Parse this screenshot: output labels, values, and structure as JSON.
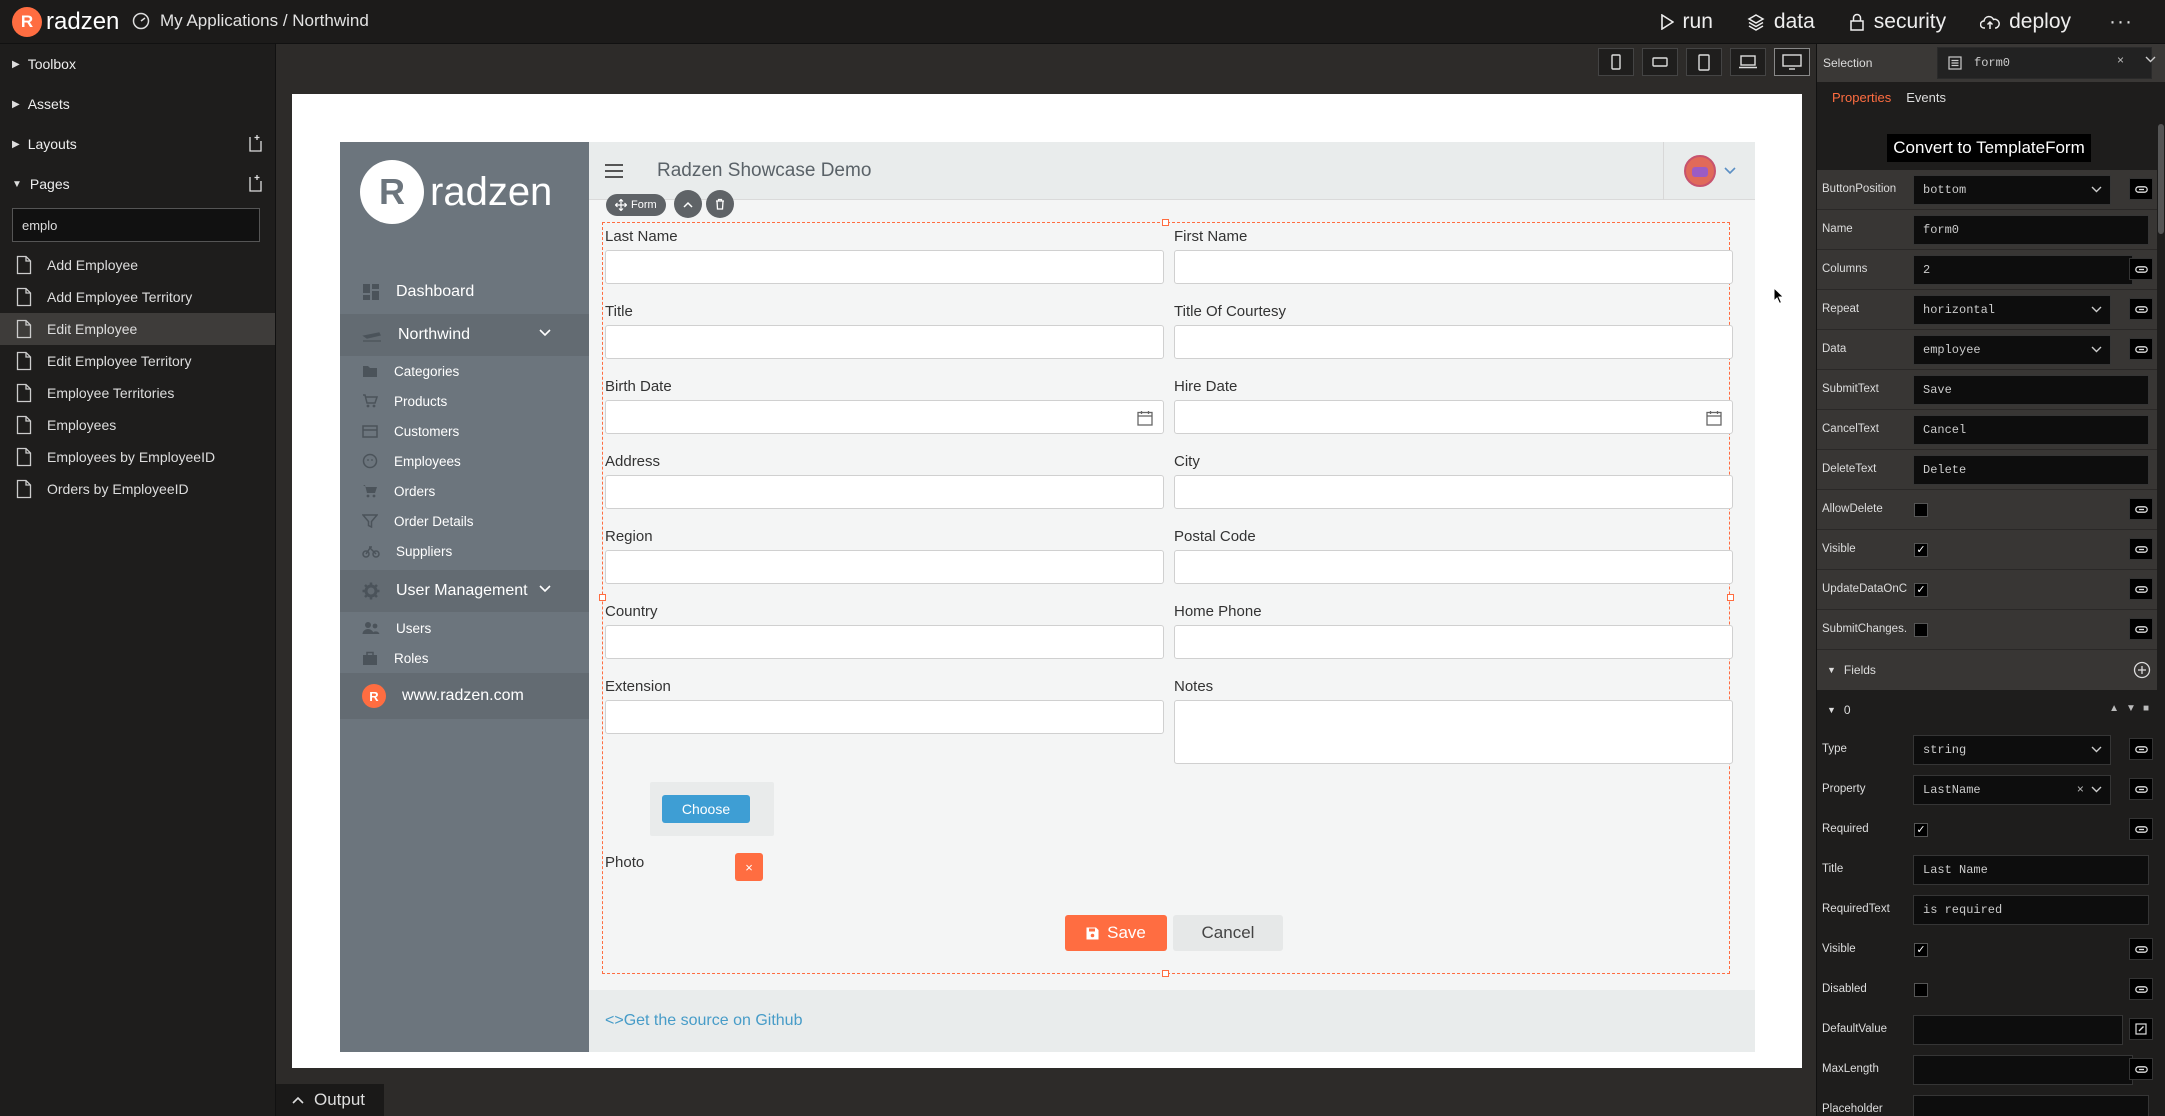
{
  "topbar": {
    "logo": "radzen",
    "breadcrumb": "My Applications / Northwind",
    "nav": [
      {
        "label": "run",
        "icon": "play-icon"
      },
      {
        "label": "data",
        "icon": "layers-icon"
      },
      {
        "label": "security",
        "icon": "lock-icon"
      },
      {
        "label": "deploy",
        "icon": "cloud-upload-icon"
      }
    ],
    "more": "···"
  },
  "left_panel": {
    "toolbox": "Toolbox",
    "assets": "Assets",
    "layouts": "Layouts",
    "pages": "Pages",
    "search_value": "emplo",
    "page_list": [
      "Add Employee",
      "Add Employee Territory",
      "Edit Employee",
      "Edit Employee Territory",
      "Employee Territories",
      "Employees",
      "Employees by EmployeeID",
      "Orders by EmployeeID"
    ],
    "active_page": "Edit Employee"
  },
  "canvas": {
    "app_logo": "radzen",
    "app_title": "Radzen Showcase Demo",
    "sidebar": {
      "dashboard": "Dashboard",
      "northwind": "Northwind",
      "northwind_items": [
        "Categories",
        "Products",
        "Customers",
        "Employees",
        "Orders",
        "Order Details",
        "Suppliers"
      ],
      "user_management": "User Management",
      "user_items": [
        "Users",
        "Roles"
      ],
      "website": "www.radzen.com"
    },
    "form_chip": "Form",
    "form": {
      "last_name": "Last Name",
      "first_name": "First Name",
      "title": "Title",
      "title_of_courtesy": "Title Of Courtesy",
      "birth_date": "Birth Date",
      "hire_date": "Hire Date",
      "address": "Address",
      "city": "City",
      "region": "Region",
      "postal_code": "Postal Code",
      "country": "Country",
      "home_phone": "Home Phone",
      "extension": "Extension",
      "notes": "Notes",
      "photo": "Photo",
      "choose": "Choose",
      "remove": "×",
      "save": "Save",
      "cancel": "Cancel"
    },
    "footer_link": "<>Get the source on Github"
  },
  "output_tab": "Output",
  "right_panel": {
    "selection_label": "Selection",
    "selection_value": "form0",
    "selection_clear": "×",
    "tabs": [
      "Properties",
      "Events"
    ],
    "convert_button": "Convert to TemplateForm",
    "properties": {
      "button_position": {
        "label": "ButtonPosition",
        "value": "bottom"
      },
      "name": {
        "label": "Name",
        "value": "form0"
      },
      "columns": {
        "label": "Columns",
        "value": "2"
      },
      "repeat": {
        "label": "Repeat",
        "value": "horizontal"
      },
      "data": {
        "label": "Data",
        "value": "employee"
      },
      "submit_text": {
        "label": "SubmitText",
        "value": "Save"
      },
      "cancel_text": {
        "label": "CancelText",
        "value": "Cancel"
      },
      "delete_text": {
        "label": "DeleteText",
        "value": "Delete"
      },
      "allow_delete": {
        "label": "AllowDelete",
        "checked": false
      },
      "visible": {
        "label": "Visible",
        "checked": true
      },
      "update_data": {
        "label": "UpdateDataOnC...",
        "checked": true
      },
      "submit_changes": {
        "label": "SubmitChanges...",
        "checked": false
      }
    },
    "fields_label": "Fields",
    "field_index": "0",
    "field_props": {
      "type": {
        "label": "Type",
        "value": "string"
      },
      "property": {
        "label": "Property",
        "value": "LastName"
      },
      "required": {
        "label": "Required",
        "checked": true
      },
      "title": {
        "label": "Title",
        "value": "Last Name"
      },
      "required_text": {
        "label": "RequiredText",
        "value": "is required"
      },
      "visible": {
        "label": "Visible",
        "checked": true
      },
      "disabled": {
        "label": "Disabled",
        "checked": false
      },
      "default_value": {
        "label": "DefaultValue",
        "value": ""
      },
      "max_length": {
        "label": "MaxLength",
        "value": ""
      },
      "placeholder": {
        "label": "Placeholder",
        "value": ""
      }
    }
  },
  "colors": {
    "accent": "#ff6d41",
    "link": "#479cc8",
    "sidebar": "#6c757d",
    "choose": "#3e9ed4"
  }
}
